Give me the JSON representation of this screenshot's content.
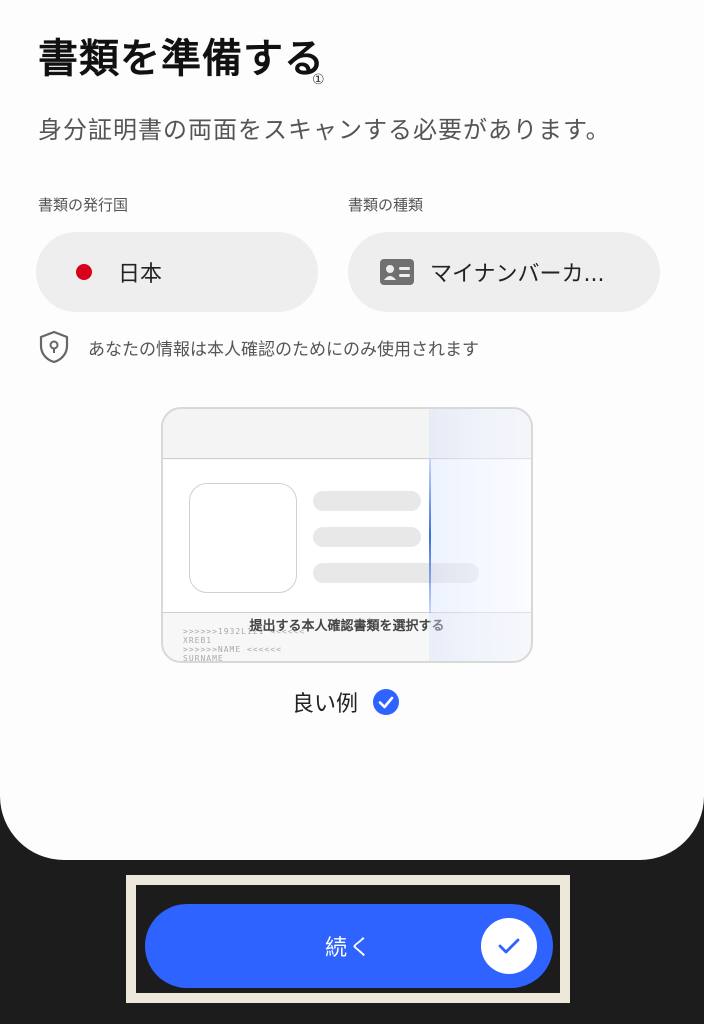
{
  "header": {
    "title": "書類を準備する",
    "title_mark": "①",
    "subtitle": "身分証明書の両面をスキャンする必要があります。"
  },
  "form": {
    "country_label": "書類の発行国",
    "country_value": "日本",
    "doctype_label": "書類の種類",
    "doctype_value": "マイナンバーカ..."
  },
  "privacy_note": "あなたの情報は本人確認のためにのみ使用されます",
  "example_card": {
    "caption": "提出する本人確認書類を選択する",
    "mrz_lines": [
      ">>>>>>1932L121 <<<<<<",
      "XREB1",
      ">>>>>>NAME <<<<<<",
      "SURNAME"
    ]
  },
  "good_example_label": "良い例",
  "cta": {
    "label": "続く"
  },
  "colors": {
    "accent": "#2e63ff",
    "flag_red": "#d9001b",
    "background": "#1c1c1c"
  },
  "icons": [
    "red-dot-flag-icon",
    "id-card-icon",
    "shield-lock-icon",
    "check-badge-icon",
    "check-icon"
  ]
}
